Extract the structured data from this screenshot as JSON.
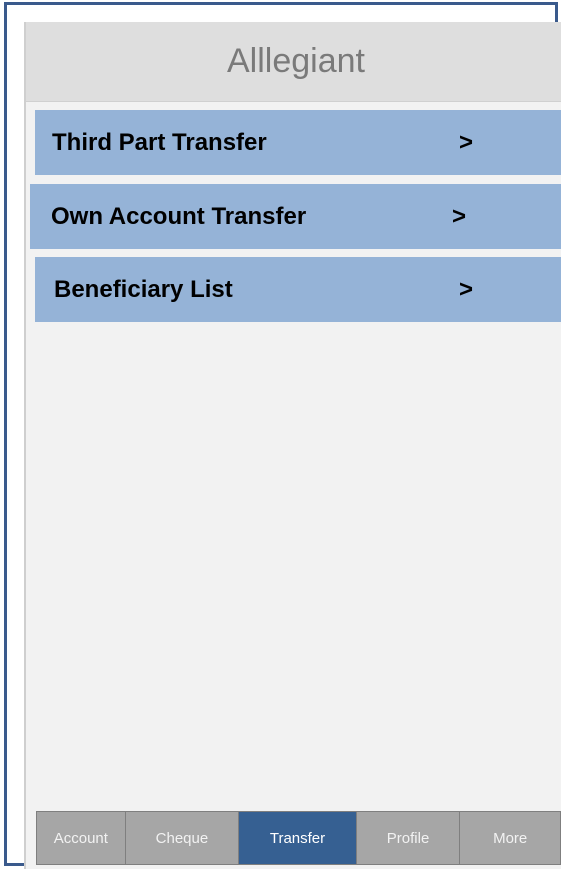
{
  "header": {
    "title": "Alllegiant"
  },
  "menu": {
    "items": [
      {
        "label": "Third Part Transfer",
        "chevron": ">"
      },
      {
        "label": "Own Account Transfer",
        "chevron": ">"
      },
      {
        "label": "Beneficiary List",
        "chevron": ">"
      }
    ]
  },
  "tabbar": {
    "tabs": [
      {
        "label": "Account"
      },
      {
        "label": "Cheque"
      },
      {
        "label": "Transfer"
      },
      {
        "label": "Profile"
      },
      {
        "label": "More"
      }
    ],
    "active": "Transfer"
  },
  "colors": {
    "frame_border": "#3a5a8c",
    "menu_item_bg": "#95b3d7",
    "tab_active_bg": "#366092",
    "tab_bg": "#a6a6a6"
  }
}
